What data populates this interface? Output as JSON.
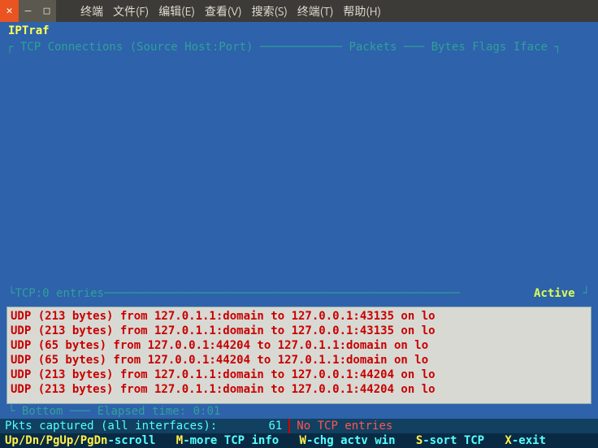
{
  "window": {
    "close": "✕",
    "min": "–",
    "max": "□"
  },
  "menu": {
    "items": [
      "终端",
      "文件(F)",
      "编辑(E)",
      "查看(V)",
      "搜索(S)",
      "终端(T)",
      "帮助(H)"
    ]
  },
  "app": {
    "title": "IPTraf"
  },
  "tcp_header": {
    "label": "TCP Connections (Source Host:Port)",
    "col_packets": "Packets",
    "col_bytes": "Bytes",
    "col_flags": "Flags",
    "col_iface": "Iface"
  },
  "tcp_footer": {
    "label": "TCP:",
    "entries": "0 entries",
    "active": "Active"
  },
  "udp_lines": [
    "UDP (213 bytes) from 127.0.1.1:domain to 127.0.0.1:43135 on lo",
    "UDP (213 bytes) from 127.0.1.1:domain to 127.0.0.1:43135 on lo",
    "UDP (65 bytes) from 127.0.0.1:44204 to 127.0.1.1:domain on lo",
    "UDP (65 bytes) from 127.0.0.1:44204 to 127.0.1.1:domain on lo",
    "UDP (213 bytes) from 127.0.1.1:domain to 127.0.0.1:44204 on lo",
    "UDP (213 bytes) from 127.0.1.1:domain to 127.0.0.1:44204 on lo"
  ],
  "bottom_info": {
    "bottom": "Bottom",
    "elapsed_label": "Elapsed time:",
    "elapsed_value": "0:01"
  },
  "status": {
    "label": "Pkts captured (all interfaces):",
    "value": "61",
    "notcp": "No TCP entries"
  },
  "help": {
    "k1": "Up/Dn/PgUp/PgDn",
    "d1": "-scroll",
    "k2": "M",
    "d2": "-more TCP info",
    "k3": "W",
    "d3": "-chg actv win",
    "k4": "S",
    "d4": "-sort TCP",
    "k5": "X",
    "d5": "-exit"
  }
}
